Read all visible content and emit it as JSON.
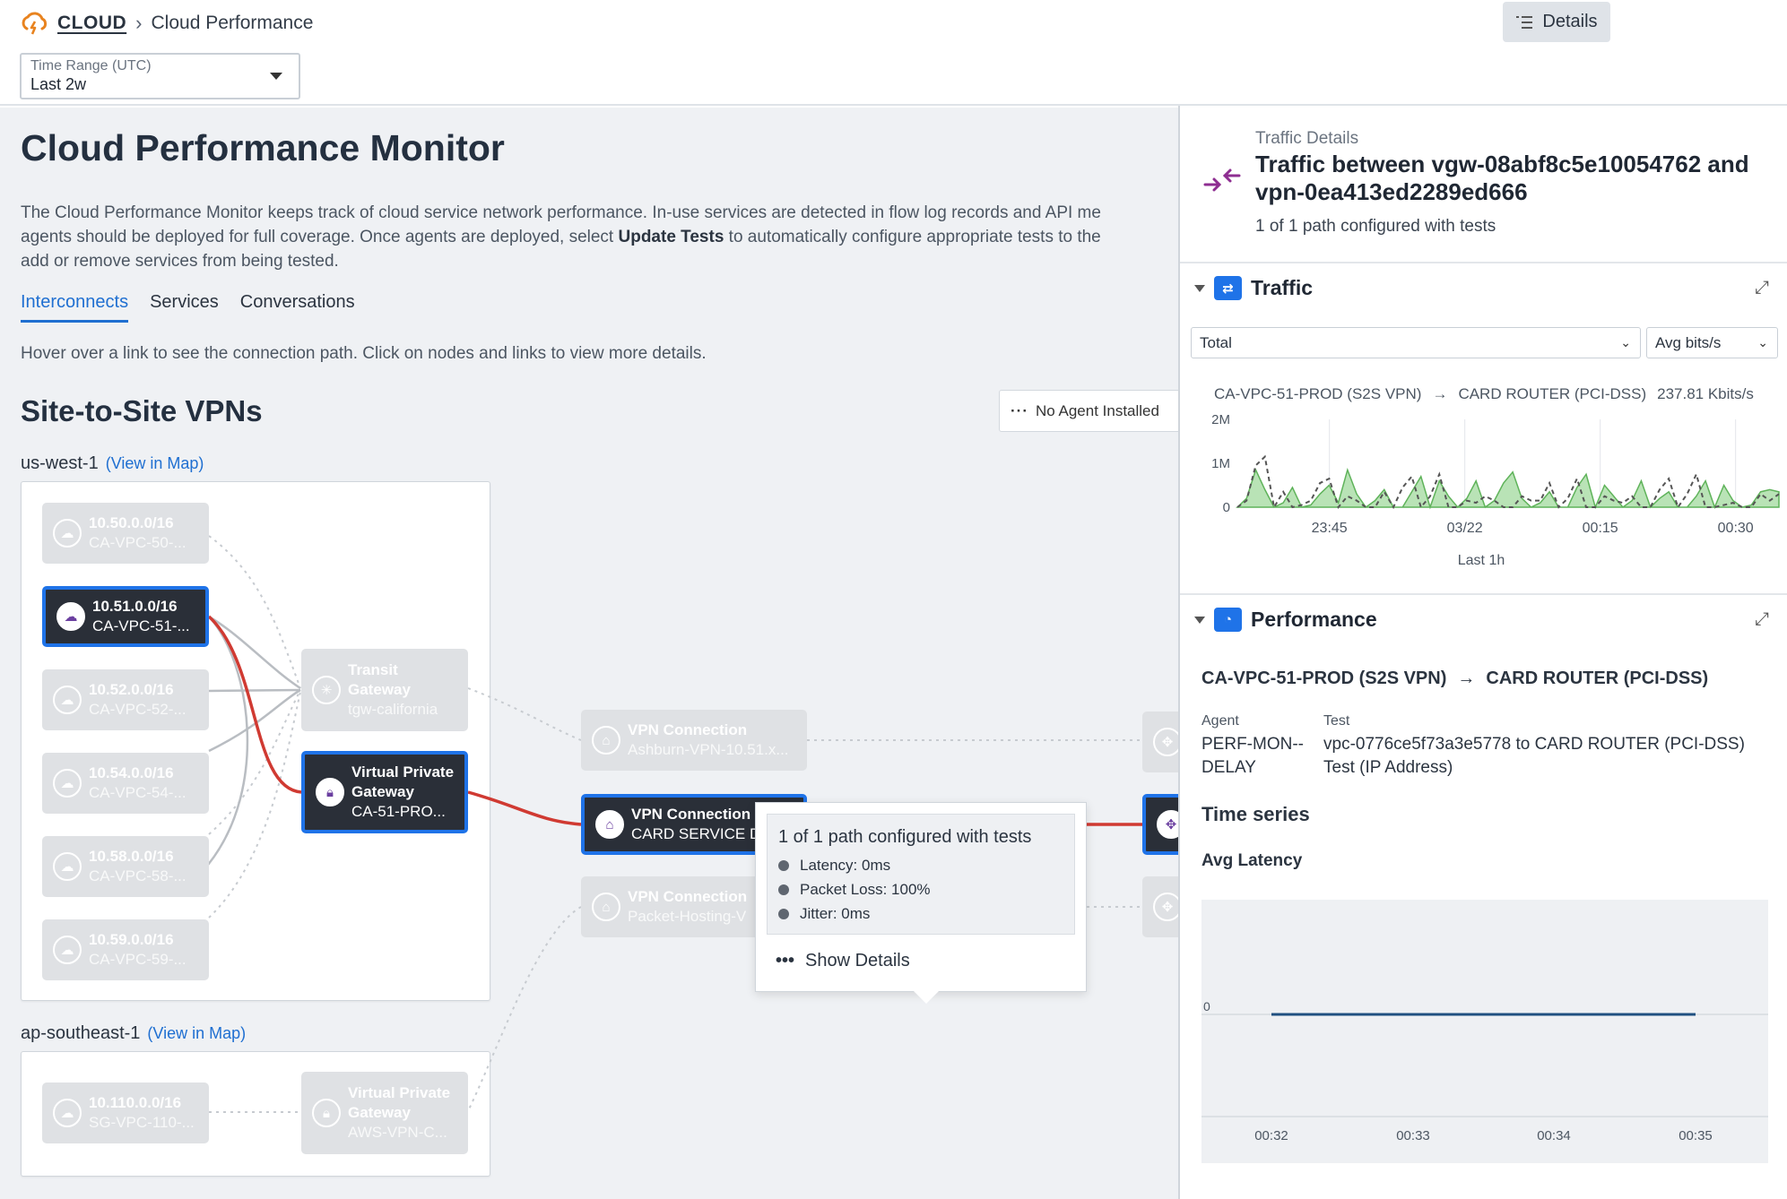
{
  "topbar": {
    "brand": "CLOUD",
    "page": "Cloud Performance",
    "time_range_label": "Time Range (UTC)",
    "time_range_value": "Last 2w",
    "details_button": "Details"
  },
  "main": {
    "title": "Cloud Performance Monitor",
    "desc_part1": "The Cloud Performance Monitor keeps track of cloud service network performance. In-use services are detected in flow log records and API me",
    "desc_part2": "agents should be deployed for full coverage. Once agents are deployed, select ",
    "desc_bold": "Update Tests",
    "desc_part3": " to automatically configure appropriate tests to the",
    "desc_part4": "add or remove services from being tested.",
    "tabs": [
      {
        "label": "Interconnects",
        "active": true
      },
      {
        "label": "Services",
        "active": false
      },
      {
        "label": "Conversations",
        "active": false
      }
    ],
    "hint": "Hover over a link to see the connection path. Click on nodes and links to view more details.",
    "section_title": "Site-to-Site VPNs",
    "legend_button": "No Agent Installed",
    "regions": [
      {
        "name": "us-west-1",
        "link": "(View in Map)"
      },
      {
        "name": "ap-southeast-1",
        "link": "(View in Map)"
      }
    ],
    "subnets": [
      {
        "cidr": "10.50.0.0/16",
        "name": "CA-VPC-50-..."
      },
      {
        "cidr": "10.51.0.0/16",
        "name": "CA-VPC-51-..."
      },
      {
        "cidr": "10.52.0.0/16",
        "name": "CA-VPC-52-..."
      },
      {
        "cidr": "10.54.0.0/16",
        "name": "CA-VPC-54-..."
      },
      {
        "cidr": "10.58.0.0/16",
        "name": "CA-VPC-58-..."
      },
      {
        "cidr": "10.59.0.0/16",
        "name": "CA-VPC-59-..."
      },
      {
        "cidr": "10.110.0.0/16",
        "name": "SG-VPC-110-..."
      }
    ],
    "transit_gateway": {
      "line1": "Transit",
      "line2": "Gateway",
      "sub": "tgw-california"
    },
    "vpg": {
      "line1": "Virtual Private",
      "line2": "Gateway",
      "sub": "CA-51-PRO..."
    },
    "vpg2": {
      "line1": "Virtual Private",
      "line2": "Gateway",
      "sub": "AWS-VPN-C..."
    },
    "vpn_connections": [
      {
        "title": "VPN Connection",
        "sub": "Ashburn-VPN-10.51.x..."
      },
      {
        "title": "VPN Connection",
        "sub": "CARD SERVICE DI"
      },
      {
        "title": "VPN Connection",
        "sub": "Packet-Hosting-V"
      }
    ],
    "popup": {
      "title": "1 of 1 path configured with tests",
      "items": [
        "Latency: 0ms",
        "Packet Loss: 100%",
        "Jitter: 0ms"
      ],
      "show_details": "Show Details"
    }
  },
  "side": {
    "subtitle": "Traffic Details",
    "title": "Traffic between vgw-08abf8c5e10054762 and vpn-0ea413ed2289ed666",
    "configured": "1 of 1 path configured with tests",
    "traffic": {
      "heading": "Traffic",
      "select_total": "Total",
      "select_metric": "Avg bits/s",
      "path_from": "CA-VPC-51-PROD (S2S VPN)",
      "path_to": "CARD ROUTER (PCI-DSS)",
      "path_value": "237.81 Kbits/s",
      "footer": "Last 1h"
    },
    "performance": {
      "heading": "Performance",
      "path_from": "CA-VPC-51-PROD (S2S VPN)",
      "path_to": "CARD ROUTER (PCI-DSS)",
      "agent_label": "Agent",
      "agent_value": "PERF-MON--DELAY",
      "test_label": "Test",
      "test_value": "vpc-0776ce5f73a3e5778 to CARD ROUTER (PCI-DSS) Test (IP Address)",
      "time_series": "Time series",
      "avg_latency": "Avg Latency"
    }
  },
  "chart_data": [
    {
      "type": "area",
      "title": "",
      "x_ticks": [
        "23:45",
        "03/22",
        "00:15",
        "00:30"
      ],
      "y_ticks": [
        "2M",
        "1M",
        "0"
      ],
      "ylim": [
        0,
        2000000
      ],
      "xlabel": "Last 1h",
      "x": [
        0,
        1,
        2,
        3,
        4,
        5,
        6,
        7,
        8,
        9,
        10,
        11,
        12,
        13,
        14,
        15,
        16,
        17,
        18,
        19,
        20,
        21,
        22,
        23,
        24,
        25,
        26,
        27,
        28,
        29,
        30,
        31,
        32,
        33,
        34,
        35,
        36,
        37,
        38,
        39,
        40,
        41,
        42,
        43,
        44,
        45,
        46,
        47,
        48,
        49,
        50,
        51,
        52,
        53,
        54,
        55,
        56,
        57,
        58,
        59
      ],
      "series": [
        {
          "values": [
            0,
            200000,
            850000,
            400000,
            0,
            100000,
            450000,
            0,
            50000,
            300000,
            500000,
            100000,
            850000,
            300000,
            0,
            150000,
            400000,
            0,
            0,
            350000,
            700000,
            0,
            600000,
            250000,
            0,
            200000,
            600000,
            0,
            150000,
            550000,
            800000,
            200000,
            0,
            100000,
            350000,
            0,
            0,
            450000,
            750000,
            0,
            500000,
            250000,
            0,
            150000,
            600000,
            0,
            200000,
            350000,
            0,
            0,
            250000,
            600000,
            0,
            500000,
            150000,
            0,
            50000,
            350000,
            400000,
            350000
          ]
        },
        {
          "values": [
            0,
            150000,
            950000,
            1150000,
            0,
            350000,
            0,
            50000,
            150000,
            550000,
            650000,
            0,
            250000,
            150000,
            0,
            0,
            350000,
            0,
            450000,
            700000,
            0,
            250000,
            750000,
            0,
            0,
            150000,
            100000,
            250000,
            150000,
            0,
            0,
            250000,
            150000,
            150000,
            550000,
            0,
            200000,
            650000,
            0,
            0,
            250000,
            150000,
            100000,
            250000,
            0,
            0,
            400000,
            650000,
            0,
            300000,
            750000,
            0,
            0,
            50000,
            100000,
            0,
            0,
            300000,
            150000,
            300000
          ]
        }
      ]
    },
    {
      "type": "line",
      "title": "Avg Latency",
      "x_ticks": [
        "00:32",
        "00:33",
        "00:34",
        "00:35"
      ],
      "y_ticks": [
        "0"
      ],
      "series": [
        {
          "values": [
            0,
            0,
            0,
            0
          ]
        }
      ]
    }
  ]
}
